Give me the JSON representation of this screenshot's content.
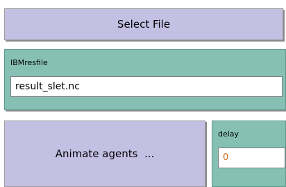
{
  "buttons": {
    "select_file": "Select File",
    "animate_agents": "Animate agents  ..."
  },
  "inputs": {
    "ibm_resfile": {
      "label": "IBMresfile",
      "value": "result_slet.nc"
    },
    "delay": {
      "label": "delay",
      "value": "0"
    }
  },
  "colors": {
    "button_bg": "#c4c0e4",
    "panel_bg": "#86c0b4",
    "delay_value": "#d2691e"
  }
}
